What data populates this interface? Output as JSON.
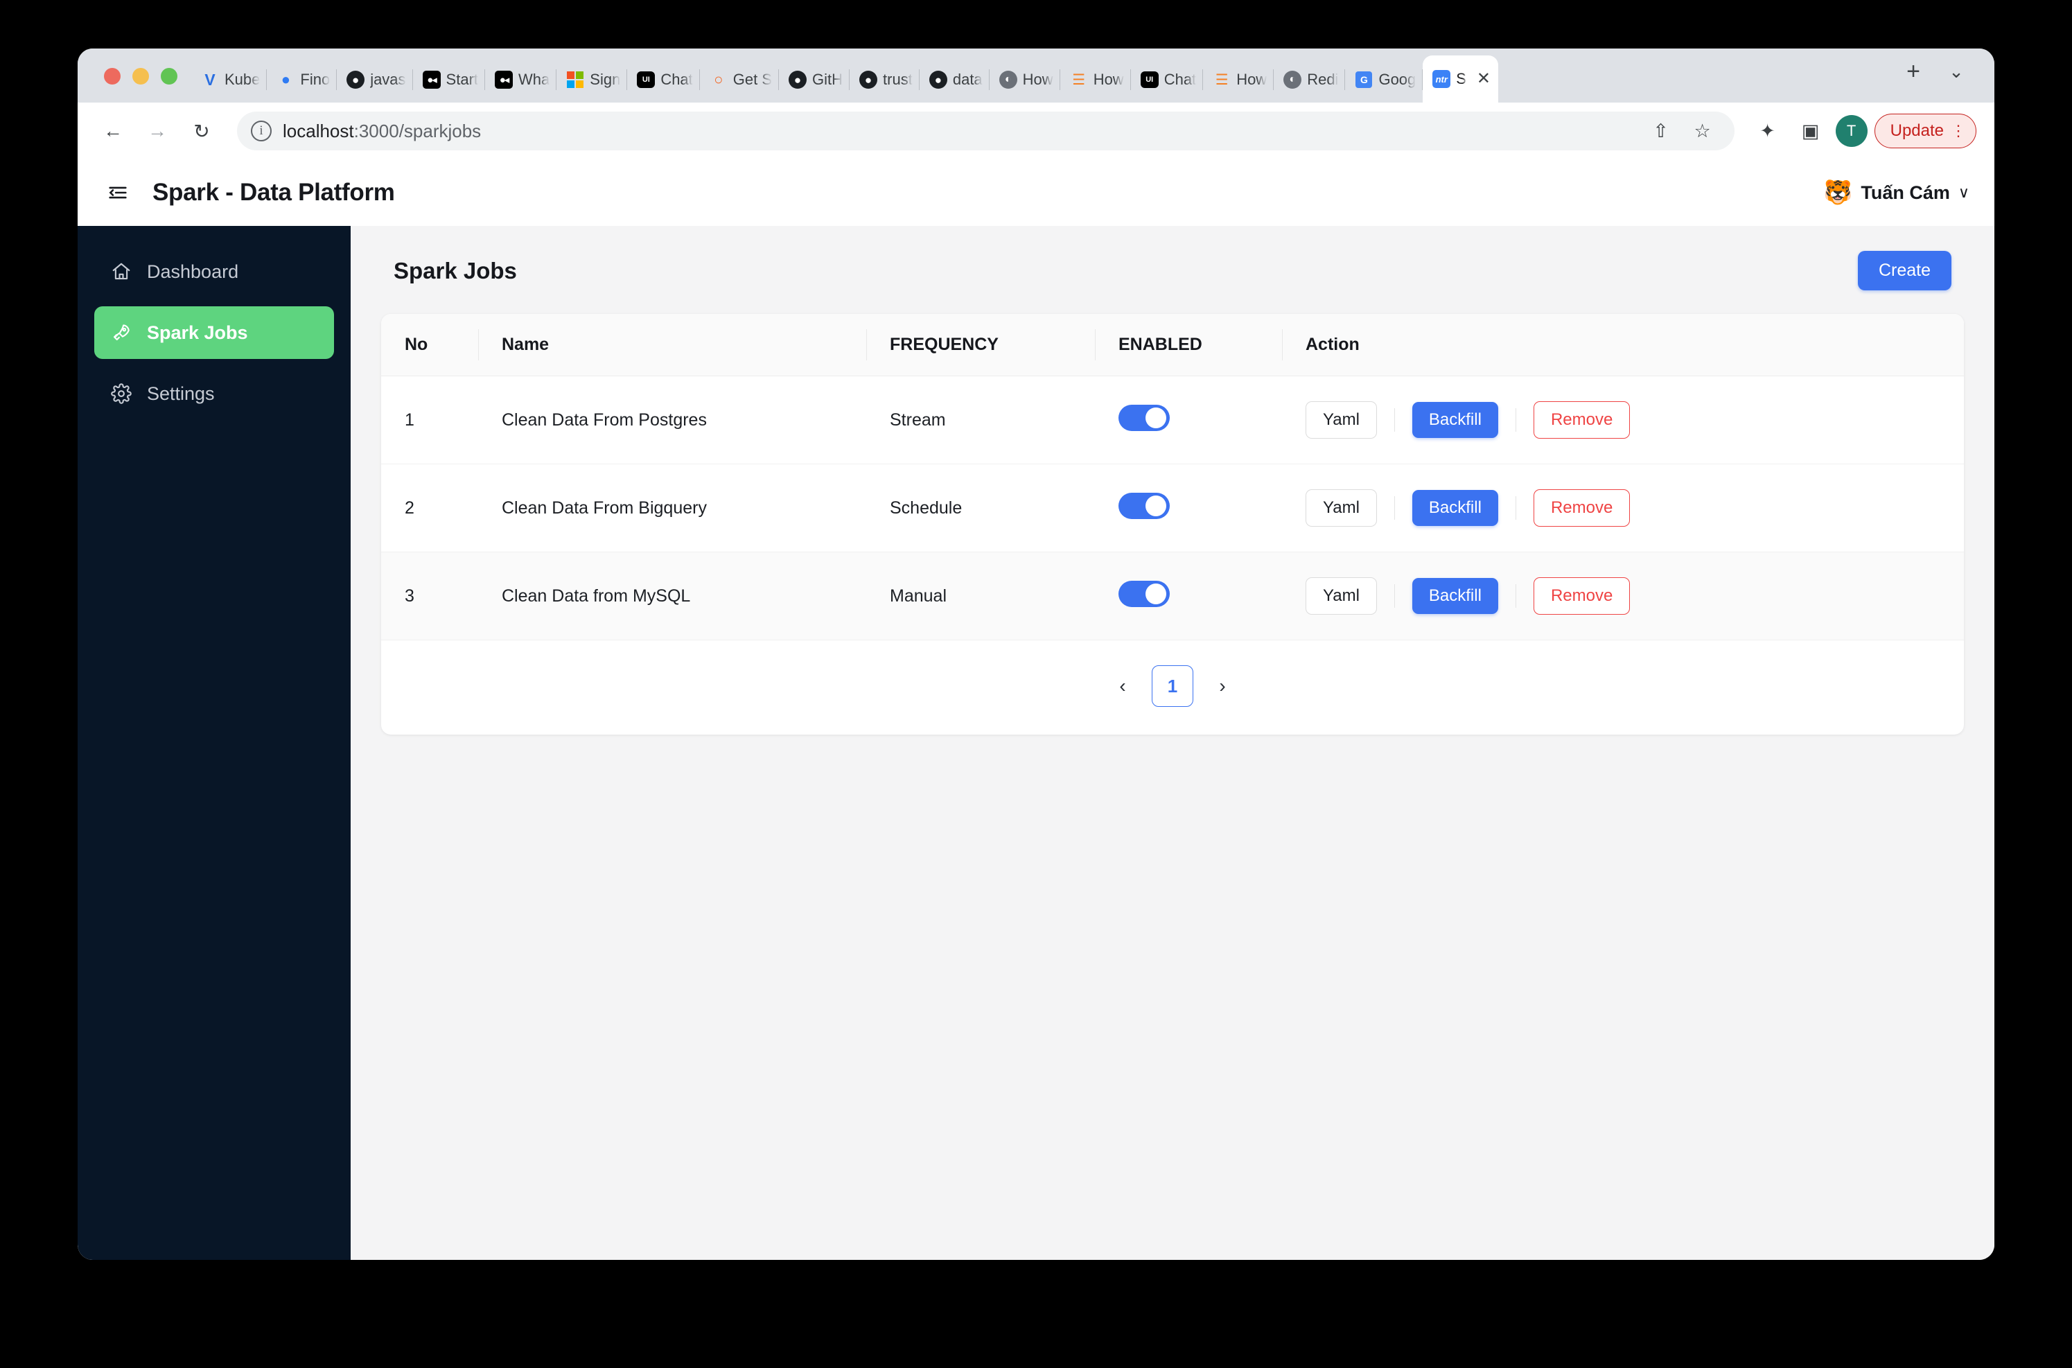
{
  "browser": {
    "tabs": [
      {
        "label": "Kube",
        "icon": "vitess-icon"
      },
      {
        "label": "Fino",
        "icon": "finops-icon"
      },
      {
        "label": "javas",
        "icon": "github-icon"
      },
      {
        "label": "Start",
        "icon": "medium-icon"
      },
      {
        "label": "Wha",
        "icon": "medium-icon"
      },
      {
        "label": "Sign",
        "icon": "microsoft-icon"
      },
      {
        "label": "Chat",
        "icon": "chat-ui-icon"
      },
      {
        "label": "Get S",
        "icon": "getstream-icon"
      },
      {
        "label": "GitH",
        "icon": "github-icon"
      },
      {
        "label": "trust",
        "icon": "github-icon"
      },
      {
        "label": "data",
        "icon": "github-icon"
      },
      {
        "label": "How",
        "icon": "globe-icon"
      },
      {
        "label": "How",
        "icon": "stackoverflow-icon"
      },
      {
        "label": "Chat",
        "icon": "chat-ui-icon"
      },
      {
        "label": "How",
        "icon": "stackoverflow-icon"
      },
      {
        "label": "Redi",
        "icon": "globe-icon"
      },
      {
        "label": "Goog",
        "icon": "google-translate-icon"
      }
    ],
    "active_tab": {
      "label": "S",
      "icon": "spark-app-icon",
      "close": "✕"
    },
    "new_tab_label": "+",
    "tab_list_chevron": "⌄",
    "back_icon": "←",
    "forward_icon": "→",
    "reload_icon": "↻",
    "url_host": "localhost",
    "url_path": ":3000/sparkjobs",
    "info_icon": "i",
    "share_icon": "⇧",
    "bookmark_icon": "☆",
    "extensions_icon": "✦",
    "sidepanel_icon": "▣",
    "profile_initial": "T",
    "update_label": "Update",
    "menu_icon": "⋮"
  },
  "appbar": {
    "collapse_icon": "collapse-sidebar-icon",
    "title": "Spark - Data Platform",
    "user_avatar": "🐯",
    "user_name": "Tuấn Cám",
    "user_chevron": "∨"
  },
  "sidebar": {
    "items": [
      {
        "label": "Dashboard",
        "icon": "home-icon",
        "active": false
      },
      {
        "label": "Spark Jobs",
        "icon": "rocket-icon",
        "active": true
      },
      {
        "label": "Settings",
        "icon": "gear-icon",
        "active": false
      }
    ]
  },
  "main": {
    "page_title": "Spark Jobs",
    "create_label": "Create",
    "table": {
      "headers": [
        "No",
        "Name",
        "FREQUENCY",
        "ENABLED",
        "Action"
      ],
      "rows": [
        {
          "no": "1",
          "name": "Clean Data From Postgres",
          "frequency": "Stream",
          "enabled": true,
          "actions": {
            "yaml": "Yaml",
            "backfill": "Backfill",
            "remove": "Remove"
          }
        },
        {
          "no": "2",
          "name": "Clean Data From Bigquery",
          "frequency": "Schedule",
          "enabled": true,
          "actions": {
            "yaml": "Yaml",
            "backfill": "Backfill",
            "remove": "Remove"
          }
        },
        {
          "no": "3",
          "name": "Clean Data from MySQL",
          "frequency": "Manual",
          "enabled": true,
          "actions": {
            "yaml": "Yaml",
            "backfill": "Backfill",
            "remove": "Remove"
          }
        }
      ]
    },
    "pagination": {
      "prev": "‹",
      "current_page": "1",
      "next": "›"
    }
  },
  "colors": {
    "accent_blue": "#3b72f0",
    "active_green": "#5ed47f",
    "sidebar_bg": "#081627",
    "danger_red": "#ef4444",
    "content_bg": "#f4f4f5"
  }
}
